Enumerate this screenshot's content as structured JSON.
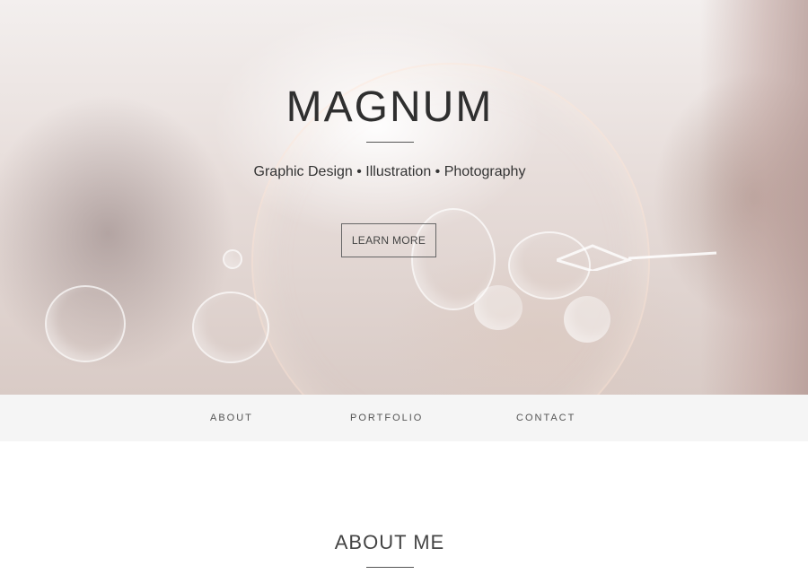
{
  "hero": {
    "title": "MAGNUM",
    "subtitle": "Graphic Design • Illustration • Photography",
    "cta_label": "LEARN MORE"
  },
  "nav": {
    "items": [
      {
        "label": "ABOUT"
      },
      {
        "label": "PORTFOLIO"
      },
      {
        "label": "CONTACT"
      }
    ]
  },
  "about": {
    "heading": "ABOUT ME"
  },
  "colors": {
    "nav_background": "#f5f5f5",
    "text_dark": "#2f2f2f",
    "rule": "#555555"
  }
}
